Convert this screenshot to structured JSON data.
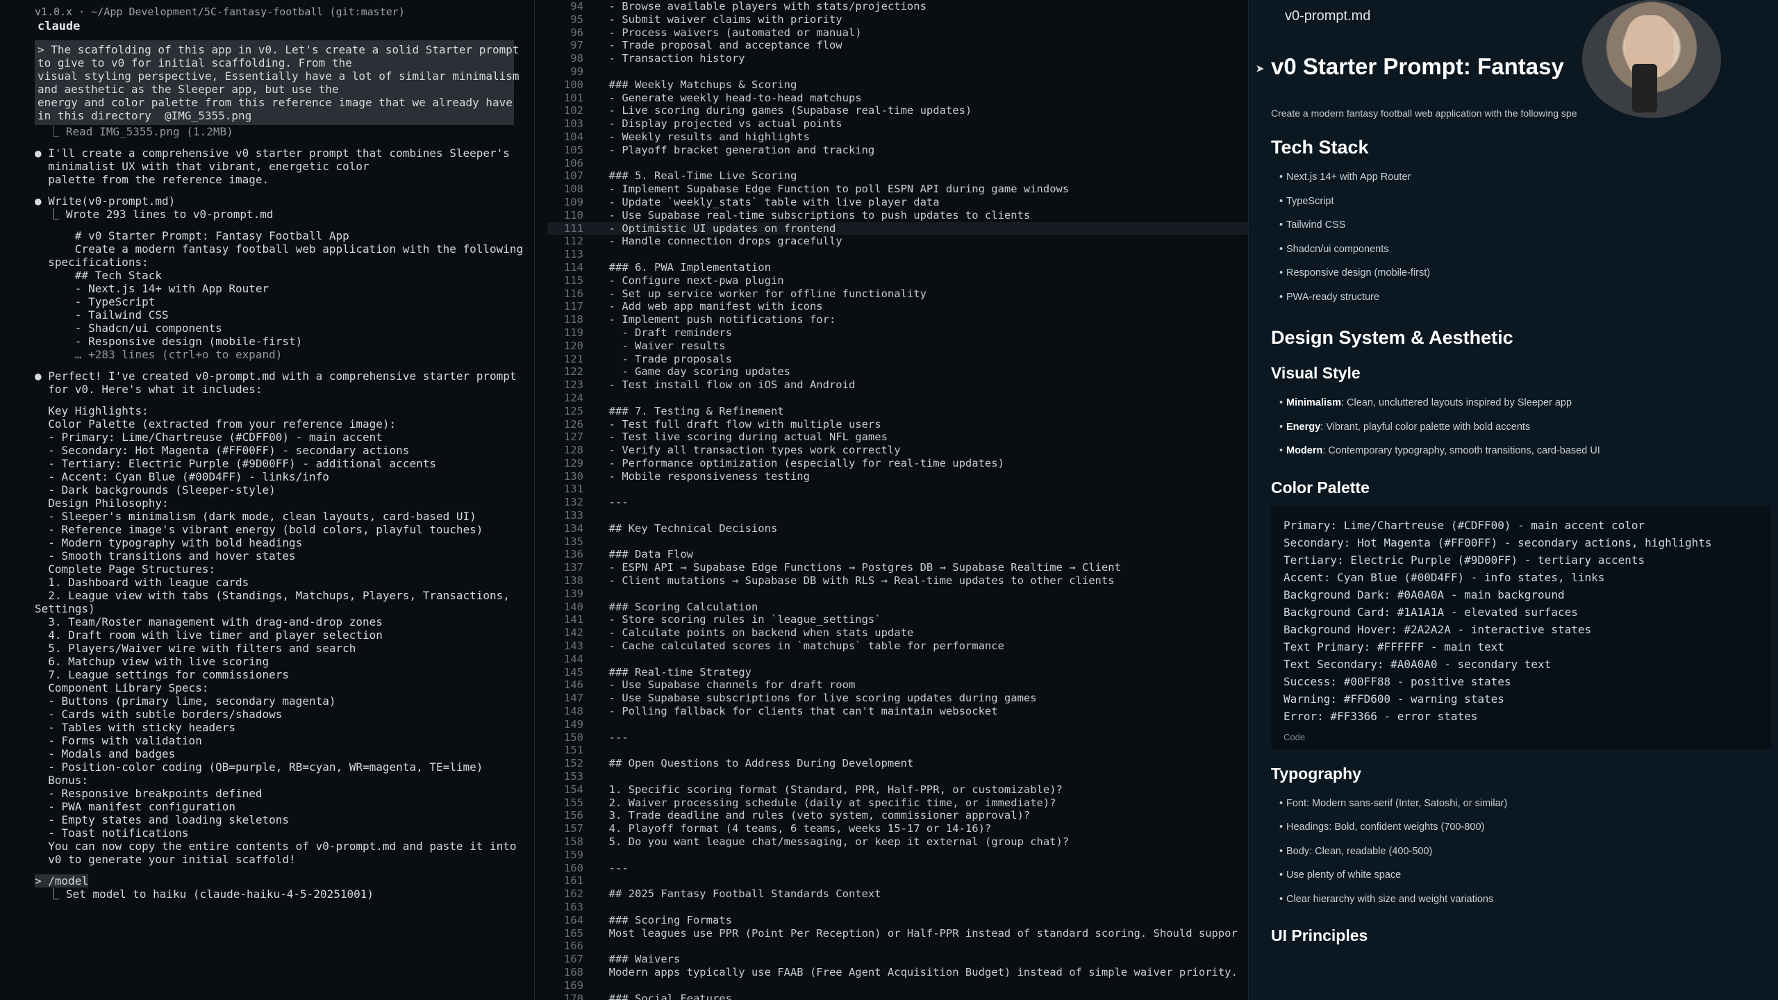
{
  "left": {
    "title": "v1.0.x · ~/App Development/5C-fantasy-football (git:master)",
    "header": "claude",
    "prompt": [
      "> The scaffolding of this app in v0. Let's create a solid Starter prompt",
      "to give to v0 for initial scaffolding. From the",
      "visual styling perspective, Essentially have a lot of similar minimalism",
      "and aesthetic as the Sleeper app, but use the",
      "energy and color palette from this reference image that we already have",
      "in this directory  @IMG_5355.png"
    ],
    "read": "  ⎿ Read IMG_5355.png (1.2MB)",
    "msg1": [
      "● I'll create a comprehensive v0 starter prompt that combines Sleeper's",
      "  minimalist UX with that vibrant, energetic color",
      "  palette from the reference image."
    ],
    "write": [
      "● Write(v0-prompt.md)",
      "  ⎿ Wrote 293 lines to v0-prompt.md"
    ],
    "preview": [
      "      # v0 Starter Prompt: Fantasy Football App",
      "      Create a modern fantasy football web application with the following",
      "  specifications:",
      "      ## Tech Stack",
      "      - Next.js 14+ with App Router",
      "      - TypeScript",
      "      - Tailwind CSS",
      "      - Shadcn/ui components",
      "      - Responsive design (mobile-first)"
    ],
    "expand": "      … +283 lines (ctrl+o to expand)",
    "msg2": [
      "● Perfect! I've created v0-prompt.md with a comprehensive starter prompt",
      "  for v0. Here's what it includes:"
    ],
    "highlights": [
      "  Key Highlights:",
      "",
      "  Color Palette (extracted from your reference image):",
      "  - Primary: Lime/Chartreuse (#CDFF00) - main accent",
      "  - Secondary: Hot Magenta (#FF00FF) - secondary actions",
      "  - Tertiary: Electric Purple (#9D00FF) - additional accents",
      "  - Accent: Cyan Blue (#00D4FF) - links/info",
      "  - Dark backgrounds (Sleeper-style)",
      "",
      "  Design Philosophy:",
      "  - Sleeper's minimalism (dark mode, clean layouts, card-based UI)",
      "  - Reference image's vibrant energy (bold colors, playful touches)",
      "  - Modern typography with bold headings",
      "  - Smooth transitions and hover states",
      "",
      "  Complete Page Structures:",
      "  1. Dashboard with league cards",
      "  2. League view with tabs (Standings, Matchups, Players, Transactions,",
      "Settings)",
      "  3. Team/Roster management with drag-and-drop zones",
      "  4. Draft room with live timer and player selection",
      "  5. Players/Waiver wire with filters and search",
      "  6. Matchup view with live scoring",
      "  7. League settings for commissioners",
      "",
      "  Component Library Specs:",
      "  - Buttons (primary lime, secondary magenta)",
      "  - Cards with subtle borders/shadows",
      "  - Tables with sticky headers",
      "  - Forms with validation",
      "  - Modals and badges",
      "  - Position-color coding (QB=purple, RB=cyan, WR=magenta, TE=lime)",
      "",
      "  Bonus:",
      "  - Responsive breakpoints defined",
      "  - PWA manifest configuration",
      "  - Empty states and loading skeletons",
      "  - Toast notifications",
      "",
      "  You can now copy the entire contents of v0-prompt.md and paste it into",
      "  v0 to generate your initial scaffold!"
    ],
    "cmd": "> /model",
    "cmd_out": "  ⎿ Set model to haiku (claude-haiku-4-5-20251001)"
  },
  "middle": {
    "lines": [
      [
        "94",
        "  - Browse available players with stats/projections"
      ],
      [
        "95",
        "  - Submit waiver claims with priority"
      ],
      [
        "96",
        "  - Process waivers (automated or manual)"
      ],
      [
        "97",
        "  - Trade proposal and acceptance flow"
      ],
      [
        "98",
        "  - Transaction history"
      ],
      [
        "99",
        ""
      ],
      [
        "100",
        "  ### Weekly Matchups & Scoring"
      ],
      [
        "101",
        "  - Generate weekly head-to-head matchups"
      ],
      [
        "102",
        "  - Live scoring during games (Supabase real-time updates)"
      ],
      [
        "103",
        "  - Display projected vs actual points"
      ],
      [
        "104",
        "  - Weekly results and highlights"
      ],
      [
        "105",
        "  - Playoff bracket generation and tracking"
      ],
      [
        "106",
        ""
      ],
      [
        "107",
        "  ### 5. Real-Time Live Scoring"
      ],
      [
        "108",
        "  - Implement Supabase Edge Function to poll ESPN API during game windows"
      ],
      [
        "109",
        "  - Update `weekly_stats` table with live player data"
      ],
      [
        "110",
        "  - Use Supabase real-time subscriptions to push updates to clients"
      ],
      [
        "111",
        "  - Optimistic UI updates on frontend"
      ],
      [
        "112",
        "  - Handle connection drops gracefully"
      ],
      [
        "113",
        ""
      ],
      [
        "114",
        "  ### 6. PWA Implementation"
      ],
      [
        "115",
        "  - Configure next-pwa plugin"
      ],
      [
        "116",
        "  - Set up service worker for offline functionality"
      ],
      [
        "117",
        "  - Add web app manifest with icons"
      ],
      [
        "118",
        "  - Implement push notifications for:"
      ],
      [
        "119",
        "    - Draft reminders"
      ],
      [
        "120",
        "    - Waiver results"
      ],
      [
        "121",
        "    - Trade proposals"
      ],
      [
        "122",
        "    - Game day scoring updates"
      ],
      [
        "123",
        "  - Test install flow on iOS and Android"
      ],
      [
        "124",
        ""
      ],
      [
        "125",
        "  ### 7. Testing & Refinement"
      ],
      [
        "126",
        "  - Test full draft flow with multiple users"
      ],
      [
        "127",
        "  - Test live scoring during actual NFL games"
      ],
      [
        "128",
        "  - Verify all transaction types work correctly"
      ],
      [
        "129",
        "  - Performance optimization (especially for real-time updates)"
      ],
      [
        "130",
        "  - Mobile responsiveness testing"
      ],
      [
        "131",
        ""
      ],
      [
        "132",
        "  ---"
      ],
      [
        "133",
        ""
      ],
      [
        "134",
        "  ## Key Technical Decisions"
      ],
      [
        "135",
        ""
      ],
      [
        "136",
        "  ### Data Flow"
      ],
      [
        "137",
        "  - ESPN API → Supabase Edge Functions → Postgres DB → Supabase Realtime → Client"
      ],
      [
        "138",
        "  - Client mutations → Supabase DB with RLS → Real-time updates to other clients"
      ],
      [
        "139",
        ""
      ],
      [
        "140",
        "  ### Scoring Calculation"
      ],
      [
        "141",
        "  - Store scoring rules in `league_settings`"
      ],
      [
        "142",
        "  - Calculate points on backend when stats update"
      ],
      [
        "143",
        "  - Cache calculated scores in `matchups` table for performance"
      ],
      [
        "144",
        ""
      ],
      [
        "145",
        "  ### Real-time Strategy"
      ],
      [
        "146",
        "  - Use Supabase channels for draft room"
      ],
      [
        "147",
        "  - Use Supabase subscriptions for live scoring updates during games"
      ],
      [
        "148",
        "  - Polling fallback for clients that can't maintain websocket"
      ],
      [
        "149",
        ""
      ],
      [
        "150",
        "  ---"
      ],
      [
        "151",
        ""
      ],
      [
        "152",
        "  ## Open Questions to Address During Development"
      ],
      [
        "153",
        ""
      ],
      [
        "154",
        "  1. Specific scoring format (Standard, PPR, Half-PPR, or customizable)?"
      ],
      [
        "155",
        "  2. Waiver processing schedule (daily at specific time, or immediate)?"
      ],
      [
        "156",
        "  3. Trade deadline and rules (veto system, commissioner approval)?"
      ],
      [
        "157",
        "  4. Playoff format (4 teams, 6 teams, weeks 15-17 or 14-16)?"
      ],
      [
        "158",
        "  5. Do you want league chat/messaging, or keep it external (group chat)?"
      ],
      [
        "159",
        ""
      ],
      [
        "160",
        "  ---"
      ],
      [
        "161",
        ""
      ],
      [
        "162",
        "  ## 2025 Fantasy Football Standards Context"
      ],
      [
        "163",
        ""
      ],
      [
        "164",
        "  ### Scoring Formats"
      ],
      [
        "165",
        "  Most leagues use PPR (Point Per Reception) or Half-PPR instead of standard scoring. Should suppor"
      ],
      [
        "166",
        ""
      ],
      [
        "167",
        "  ### Waivers"
      ],
      [
        "168",
        "  Modern apps typically use FAAB (Free Agent Acquisition Budget) instead of simple waiver priority."
      ],
      [
        "169",
        ""
      ],
      [
        "170",
        "  ### Social Features"
      ]
    ]
  },
  "right": {
    "filename": "v0-prompt.md",
    "title": "v0 Starter Prompt: Fantasy",
    "intro": "Create a modern fantasy football web application with the following spe",
    "tech_heading": "Tech Stack",
    "tech": [
      "Next.js 14+ with App Router",
      "TypeScript",
      "Tailwind CSS",
      "Shadcn/ui components",
      "Responsive design (mobile-first)",
      "PWA-ready structure"
    ],
    "design_heading": "Design System & Aesthetic",
    "visual_heading": "Visual Style",
    "visual": [
      {
        "k": "Minimalism",
        "v": ": Clean, uncluttered layouts inspired by Sleeper app"
      },
      {
        "k": "Energy",
        "v": ": Vibrant, playful color palette with bold accents"
      },
      {
        "k": "Modern",
        "v": ": Contemporary typography, smooth transitions, card-based UI"
      }
    ],
    "palette_heading": "Color Palette",
    "palette": [
      "Primary: Lime/Chartreuse (#CDFF00) - main accent color",
      "Secondary: Hot Magenta (#FF00FF) - secondary actions, highlights",
      "Tertiary: Electric Purple (#9D00FF) - tertiary accents",
      "Accent: Cyan Blue (#00D4FF) - info states, links",
      "Background Dark: #0A0A0A - main background",
      "Background Card: #1A1A1A - elevated surfaces",
      "Background Hover: #2A2A2A - interactive states",
      "Text Primary: #FFFFFF - main text",
      "Text Secondary: #A0A0A0 - secondary text",
      "Success: #00FF88 - positive states",
      "Warning: #FFD600 - warning states",
      "Error: #FF3366 - error states"
    ],
    "code_label": "Code",
    "typo_heading": "Typography",
    "typo": [
      "Font: Modern sans-serif (Inter, Satoshi, or similar)",
      "Headings: Bold, confident weights (700-800)",
      "Body: Clean, readable (400-500)",
      "Use plenty of white space",
      "Clear hierarchy with size and weight variations"
    ],
    "ui_heading": "UI Principles"
  }
}
